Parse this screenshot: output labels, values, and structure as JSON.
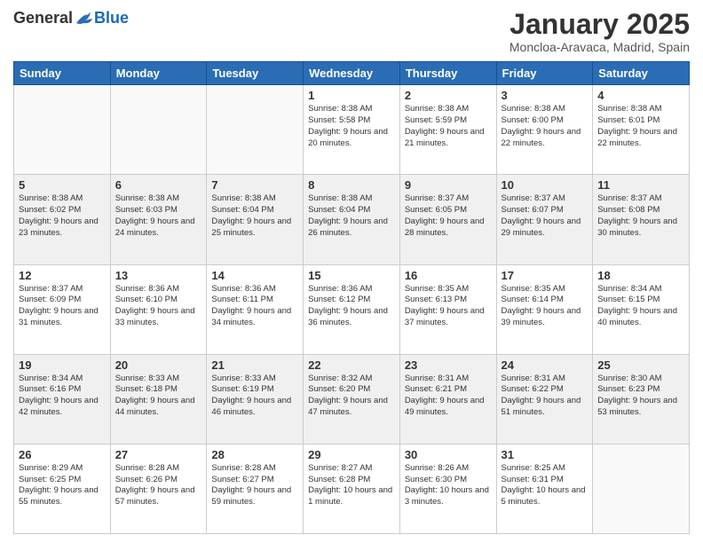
{
  "logo": {
    "general": "General",
    "blue": "Blue"
  },
  "title": "January 2025",
  "location": "Moncloa-Aravaca, Madrid, Spain",
  "days_header": [
    "Sunday",
    "Monday",
    "Tuesday",
    "Wednesday",
    "Thursday",
    "Friday",
    "Saturday"
  ],
  "weeks": [
    {
      "shaded": false,
      "days": [
        {
          "num": "",
          "info": ""
        },
        {
          "num": "",
          "info": ""
        },
        {
          "num": "",
          "info": ""
        },
        {
          "num": "1",
          "info": "Sunrise: 8:38 AM\nSunset: 5:58 PM\nDaylight: 9 hours\nand 20 minutes."
        },
        {
          "num": "2",
          "info": "Sunrise: 8:38 AM\nSunset: 5:59 PM\nDaylight: 9 hours\nand 21 minutes."
        },
        {
          "num": "3",
          "info": "Sunrise: 8:38 AM\nSunset: 6:00 PM\nDaylight: 9 hours\nand 22 minutes."
        },
        {
          "num": "4",
          "info": "Sunrise: 8:38 AM\nSunset: 6:01 PM\nDaylight: 9 hours\nand 22 minutes."
        }
      ]
    },
    {
      "shaded": true,
      "days": [
        {
          "num": "5",
          "info": "Sunrise: 8:38 AM\nSunset: 6:02 PM\nDaylight: 9 hours\nand 23 minutes."
        },
        {
          "num": "6",
          "info": "Sunrise: 8:38 AM\nSunset: 6:03 PM\nDaylight: 9 hours\nand 24 minutes."
        },
        {
          "num": "7",
          "info": "Sunrise: 8:38 AM\nSunset: 6:04 PM\nDaylight: 9 hours\nand 25 minutes."
        },
        {
          "num": "8",
          "info": "Sunrise: 8:38 AM\nSunset: 6:04 PM\nDaylight: 9 hours\nand 26 minutes."
        },
        {
          "num": "9",
          "info": "Sunrise: 8:37 AM\nSunset: 6:05 PM\nDaylight: 9 hours\nand 28 minutes."
        },
        {
          "num": "10",
          "info": "Sunrise: 8:37 AM\nSunset: 6:07 PM\nDaylight: 9 hours\nand 29 minutes."
        },
        {
          "num": "11",
          "info": "Sunrise: 8:37 AM\nSunset: 6:08 PM\nDaylight: 9 hours\nand 30 minutes."
        }
      ]
    },
    {
      "shaded": false,
      "days": [
        {
          "num": "12",
          "info": "Sunrise: 8:37 AM\nSunset: 6:09 PM\nDaylight: 9 hours\nand 31 minutes."
        },
        {
          "num": "13",
          "info": "Sunrise: 8:36 AM\nSunset: 6:10 PM\nDaylight: 9 hours\nand 33 minutes."
        },
        {
          "num": "14",
          "info": "Sunrise: 8:36 AM\nSunset: 6:11 PM\nDaylight: 9 hours\nand 34 minutes."
        },
        {
          "num": "15",
          "info": "Sunrise: 8:36 AM\nSunset: 6:12 PM\nDaylight: 9 hours\nand 36 minutes."
        },
        {
          "num": "16",
          "info": "Sunrise: 8:35 AM\nSunset: 6:13 PM\nDaylight: 9 hours\nand 37 minutes."
        },
        {
          "num": "17",
          "info": "Sunrise: 8:35 AM\nSunset: 6:14 PM\nDaylight: 9 hours\nand 39 minutes."
        },
        {
          "num": "18",
          "info": "Sunrise: 8:34 AM\nSunset: 6:15 PM\nDaylight: 9 hours\nand 40 minutes."
        }
      ]
    },
    {
      "shaded": true,
      "days": [
        {
          "num": "19",
          "info": "Sunrise: 8:34 AM\nSunset: 6:16 PM\nDaylight: 9 hours\nand 42 minutes."
        },
        {
          "num": "20",
          "info": "Sunrise: 8:33 AM\nSunset: 6:18 PM\nDaylight: 9 hours\nand 44 minutes."
        },
        {
          "num": "21",
          "info": "Sunrise: 8:33 AM\nSunset: 6:19 PM\nDaylight: 9 hours\nand 46 minutes."
        },
        {
          "num": "22",
          "info": "Sunrise: 8:32 AM\nSunset: 6:20 PM\nDaylight: 9 hours\nand 47 minutes."
        },
        {
          "num": "23",
          "info": "Sunrise: 8:31 AM\nSunset: 6:21 PM\nDaylight: 9 hours\nand 49 minutes."
        },
        {
          "num": "24",
          "info": "Sunrise: 8:31 AM\nSunset: 6:22 PM\nDaylight: 9 hours\nand 51 minutes."
        },
        {
          "num": "25",
          "info": "Sunrise: 8:30 AM\nSunset: 6:23 PM\nDaylight: 9 hours\nand 53 minutes."
        }
      ]
    },
    {
      "shaded": false,
      "days": [
        {
          "num": "26",
          "info": "Sunrise: 8:29 AM\nSunset: 6:25 PM\nDaylight: 9 hours\nand 55 minutes."
        },
        {
          "num": "27",
          "info": "Sunrise: 8:28 AM\nSunset: 6:26 PM\nDaylight: 9 hours\nand 57 minutes."
        },
        {
          "num": "28",
          "info": "Sunrise: 8:28 AM\nSunset: 6:27 PM\nDaylight: 9 hours\nand 59 minutes."
        },
        {
          "num": "29",
          "info": "Sunrise: 8:27 AM\nSunset: 6:28 PM\nDaylight: 10 hours\nand 1 minute."
        },
        {
          "num": "30",
          "info": "Sunrise: 8:26 AM\nSunset: 6:30 PM\nDaylight: 10 hours\nand 3 minutes."
        },
        {
          "num": "31",
          "info": "Sunrise: 8:25 AM\nSunset: 6:31 PM\nDaylight: 10 hours\nand 5 minutes."
        },
        {
          "num": "",
          "info": ""
        }
      ]
    }
  ]
}
